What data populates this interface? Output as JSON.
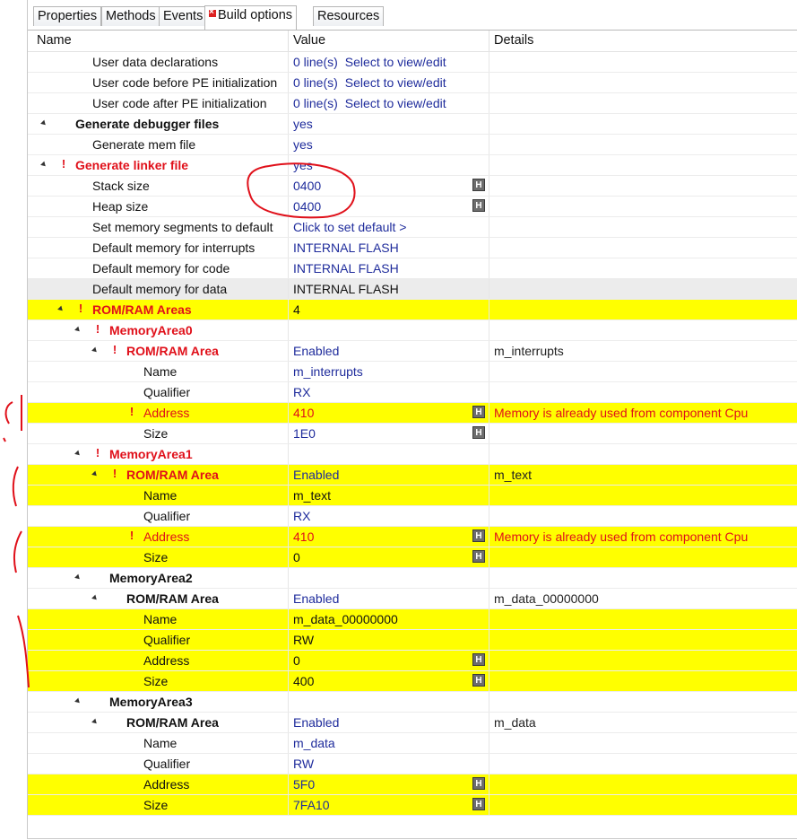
{
  "tabs": [
    {
      "label": "Properties"
    },
    {
      "label": "Methods"
    },
    {
      "label": "Events"
    },
    {
      "label": "Build options",
      "active": true,
      "error_icon": "error-x-icon"
    },
    {
      "label": "Resources"
    }
  ],
  "columns": {
    "name": "Name",
    "value": "Value",
    "details": "Details"
  },
  "rows": [
    {
      "name": "User data declarations",
      "value": "0 line(s)",
      "value_link": "Select to view/edit"
    },
    {
      "name": "User code before PE initialization",
      "value": "0 line(s)",
      "value_link": "Select to view/edit"
    },
    {
      "name": "User code after PE initialization",
      "value": "0 line(s)",
      "value_link": "Select to view/edit"
    },
    {
      "name": "Generate debugger files",
      "value": "yes"
    },
    {
      "name": "Generate mem file",
      "value": "yes"
    },
    {
      "name": "Generate linker file",
      "value": "yes"
    },
    {
      "name": "Stack size",
      "value": "0400",
      "badge": "H"
    },
    {
      "name": "Heap size",
      "value": "0400",
      "badge": "H"
    },
    {
      "name": "Set memory segments to default",
      "value": "Click to set default >"
    },
    {
      "name": "Default memory for interrupts",
      "value": "INTERNAL FLASH"
    },
    {
      "name": "Default memory for code",
      "value": "INTERNAL FLASH"
    },
    {
      "name": "Default memory for data",
      "value": "INTERNAL FLASH"
    },
    {
      "name": "ROM/RAM Areas",
      "value": "4"
    },
    {
      "name": "MemoryArea0",
      "value": ""
    },
    {
      "name": "ROM/RAM Area",
      "value": "Enabled",
      "details": "m_interrupts"
    },
    {
      "name": "Name",
      "value": "m_interrupts"
    },
    {
      "name": "Qualifier",
      "value": "RX"
    },
    {
      "name": "Address",
      "value": "410",
      "badge": "H",
      "details": "Memory is already used from component Cpu"
    },
    {
      "name": "Size",
      "value": "1E0",
      "badge": "H"
    },
    {
      "name": "MemoryArea1",
      "value": ""
    },
    {
      "name": "ROM/RAM Area",
      "value": "Enabled",
      "details": "m_text"
    },
    {
      "name": "Name",
      "value": "m_text"
    },
    {
      "name": "Qualifier",
      "value": "RX"
    },
    {
      "name": "Address",
      "value": "410",
      "badge": "H",
      "details": "Memory is already used from component Cpu"
    },
    {
      "name": "Size",
      "value": "0",
      "badge": "H"
    },
    {
      "name": "MemoryArea2",
      "value": ""
    },
    {
      "name": "ROM/RAM Area",
      "value": "Enabled",
      "details": "m_data_00000000"
    },
    {
      "name": "Name",
      "value": "m_data_00000000"
    },
    {
      "name": "Qualifier",
      "value": "RW"
    },
    {
      "name": "Address",
      "value": "0",
      "badge": "H"
    },
    {
      "name": "Size",
      "value": "400",
      "badge": "H"
    },
    {
      "name": "MemoryArea3",
      "value": ""
    },
    {
      "name": "ROM/RAM Area",
      "value": "Enabled",
      "details": "m_data"
    },
    {
      "name": "Name",
      "value": "m_data"
    },
    {
      "name": "Qualifier",
      "value": "RW"
    },
    {
      "name": "Address",
      "value": "5F0",
      "badge": "H"
    },
    {
      "name": "Size",
      "value": "7FA10",
      "badge": "H"
    }
  ],
  "colors": {
    "highlight": "#ffff00",
    "error": "#e0101a",
    "value_text": "#1f2c9c",
    "annotation": "#e0101a"
  },
  "icons": {
    "expand": "tree-expanded-icon",
    "warning": "error-marker-icon",
    "hint": "h-badge-icon"
  }
}
